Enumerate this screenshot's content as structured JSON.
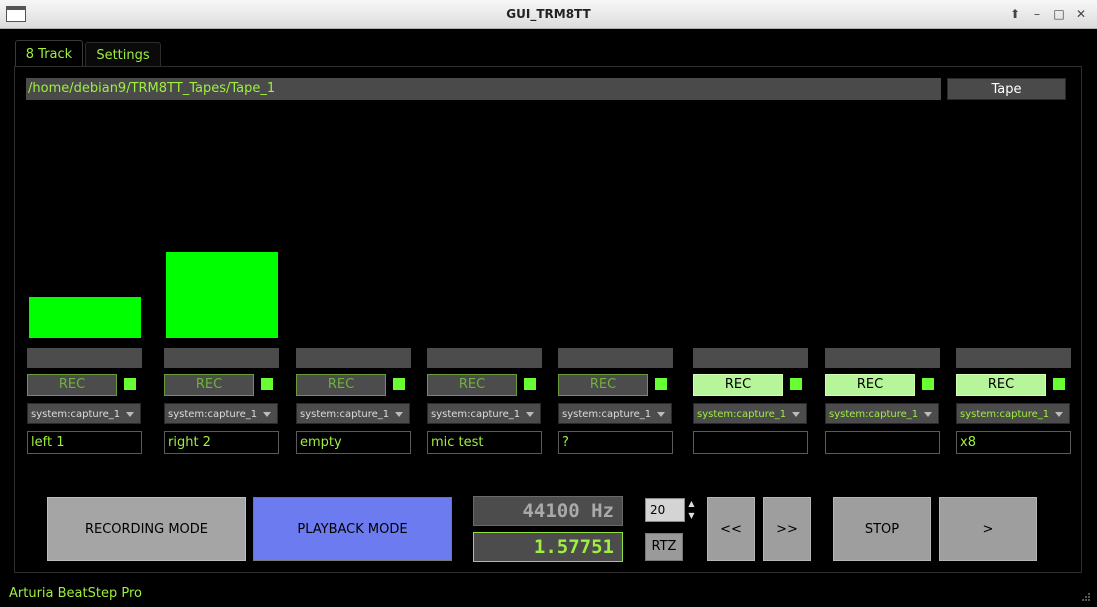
{
  "window": {
    "title": "GUI_TRM8TT",
    "controls": [
      "up",
      "minimize",
      "maximize",
      "close"
    ]
  },
  "tabs": [
    {
      "label": "8 Track",
      "selected": true
    },
    {
      "label": "Settings",
      "selected": false
    }
  ],
  "tape": {
    "path": "/home/debian9/TRM8TT_Tapes/Tape_1",
    "button_label": "Tape"
  },
  "tracks": [
    {
      "rec_label": "REC",
      "armed": false,
      "input": "system:capture_1",
      "name": "left 1",
      "level": 0.45
    },
    {
      "rec_label": "REC",
      "armed": false,
      "input": "system:capture_1",
      "name": "right 2",
      "level": 0.95
    },
    {
      "rec_label": "REC",
      "armed": false,
      "input": "system:capture_1",
      "name": "empty",
      "level": 0
    },
    {
      "rec_label": "REC",
      "armed": false,
      "input": "system:capture_1",
      "name": "mic test",
      "level": 0
    },
    {
      "rec_label": "REC",
      "armed": false,
      "input": "system:capture_1",
      "name": "?",
      "level": 0
    },
    {
      "rec_label": "REC",
      "armed": true,
      "input": "system:capture_1",
      "name": "",
      "level": 0
    },
    {
      "rec_label": "REC",
      "armed": true,
      "input": "system:capture_1",
      "name": "",
      "level": 0
    },
    {
      "rec_label": "REC",
      "armed": true,
      "input": "system:capture_1",
      "name": "x8",
      "level": 0
    }
  ],
  "transport": {
    "recording_mode_label": "RECORDING MODE",
    "playback_mode_label": "PLAYBACK MODE",
    "sample_rate": "44100 Hz",
    "position": "1.57751",
    "spin_value": "20",
    "rtz_label": "RTZ",
    "rewind_label": "<<",
    "forward_label": ">>",
    "stop_label": "STOP",
    "play_label": ">"
  },
  "status": {
    "device": "Arturia BeatStep Pro"
  },
  "colors": {
    "accent_green": "#9fef3f",
    "meter_green": "#00ff00",
    "rec_armed": "#b7f59a",
    "playback_active": "#6c7cf0"
  }
}
